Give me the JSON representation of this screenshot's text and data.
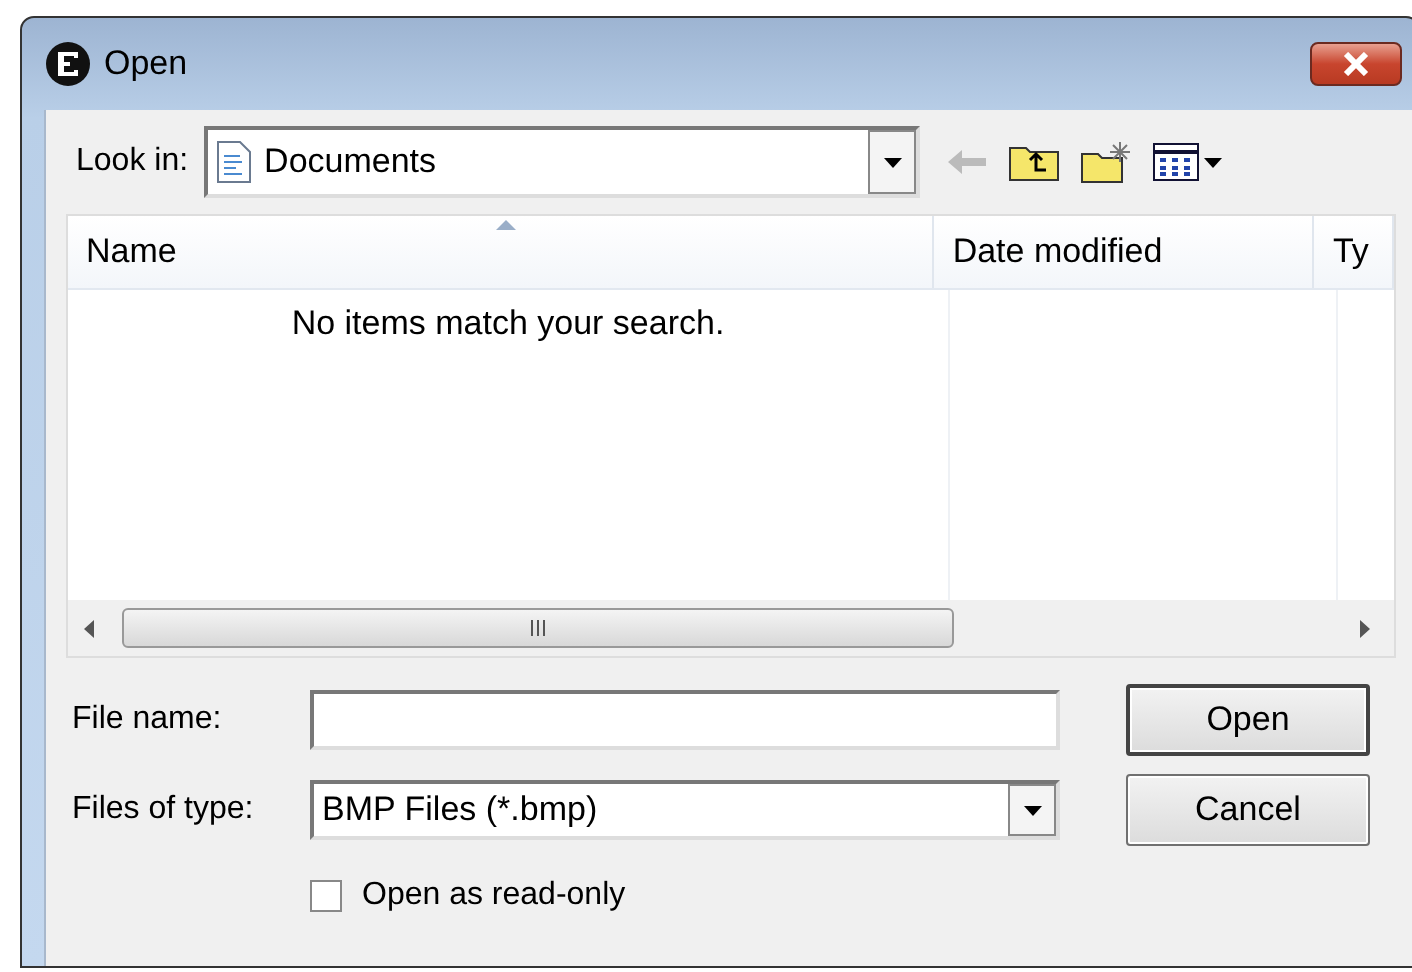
{
  "window": {
    "title": "Open"
  },
  "look_in": {
    "label": "Look in:",
    "value": "Documents"
  },
  "file_list": {
    "columns": [
      "Name",
      "Date modified",
      "Ty"
    ],
    "empty_message": "No items match your search."
  },
  "file_name": {
    "label": "File name:"
  },
  "files_of_type": {
    "label": "Files of type:",
    "value": "BMP Files (*.bmp)"
  },
  "buttons": [
    "Open",
    "Cancel"
  ],
  "read_only": {
    "label": "Open as read-only",
    "checked": false
  }
}
